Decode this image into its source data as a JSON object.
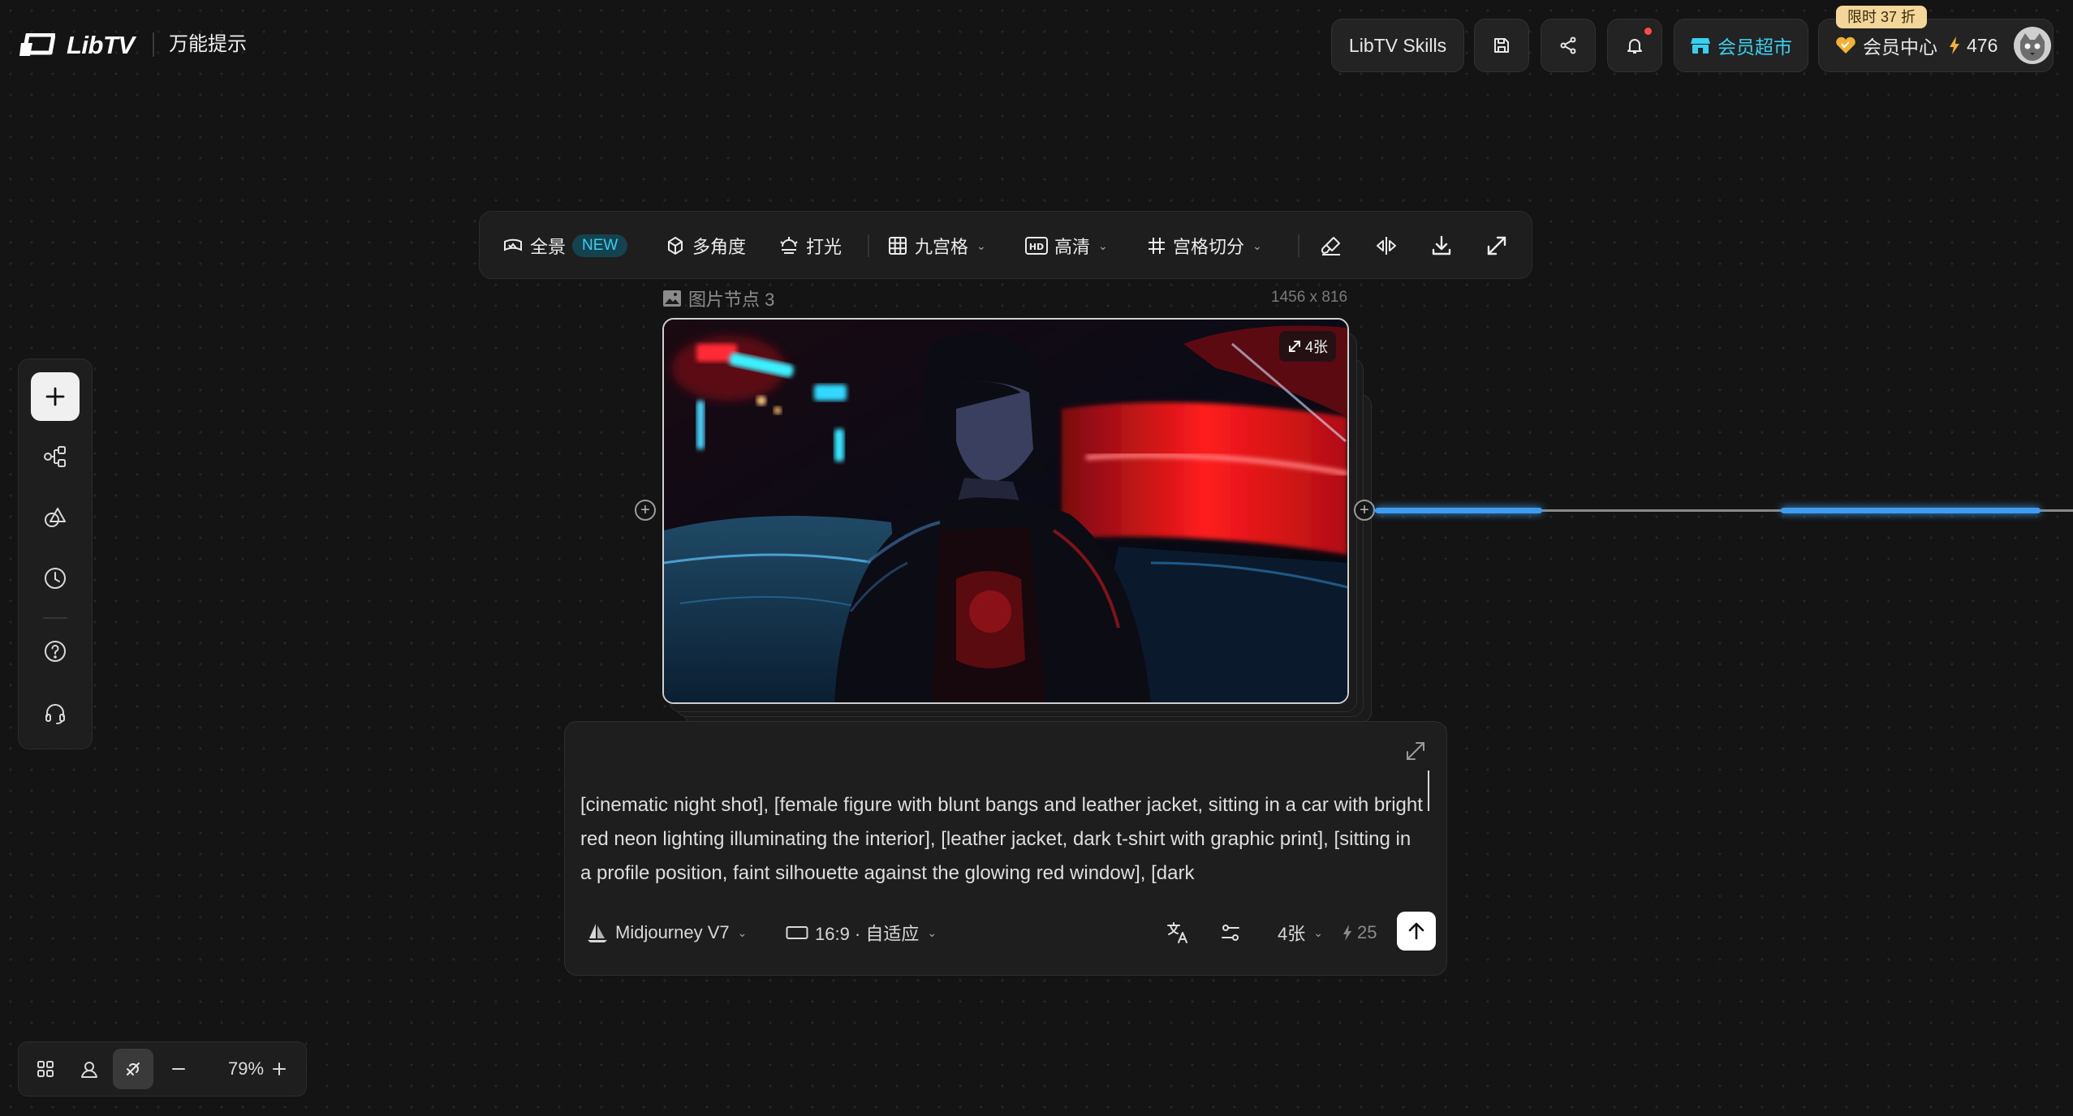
{
  "header": {
    "logo_text": "LibTV",
    "app_title": "万能提示",
    "skills_label": "LibTV Skills",
    "market_label": "会员超市",
    "promo_badge": "限时 37 折",
    "member_center_label": "会员中心",
    "credits": "476"
  },
  "toolbar": {
    "panorama_label": "全景",
    "new_badge": "NEW",
    "multi_angle_label": "多角度",
    "lighting_label": "打光",
    "grid_label": "九宫格",
    "hd_label": "高清",
    "slice_label": "宫格切分"
  },
  "node": {
    "label": "图片节点 3",
    "size": "1456 x 816",
    "count_badge": "4张"
  },
  "prompt": {
    "text": "[cinematic night shot], [female figure with blunt bangs and leather jacket, sitting in a car with bright red neon lighting illuminating the interior], [leather jacket, dark t-shirt with graphic print], [sitting in a profile position, faint silhouette against the glowing red window], [dark",
    "model_label": "Midjourney V7",
    "ratio_label": "16:9 · 自适应",
    "count_label": "4张",
    "cost": "25"
  },
  "zoom": {
    "level": "79%"
  },
  "colors": {
    "accent_cyan": "#39d0f0",
    "connector_glow": "#3f9df0",
    "notification": "#ff4a4a",
    "promo_gold": "#f3d79a"
  }
}
